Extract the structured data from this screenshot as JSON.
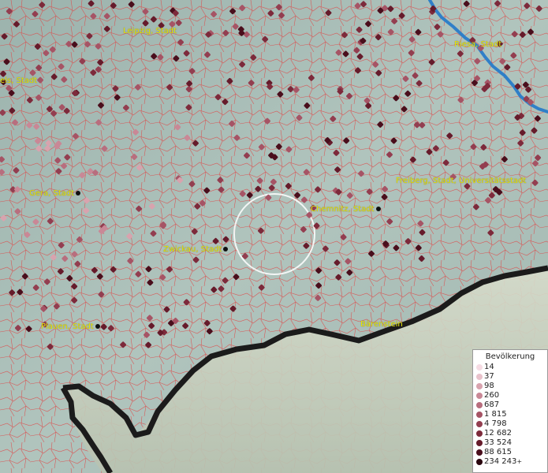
{
  "colors": {
    "background": "#a9bfb8",
    "district_border": "#e23a3a",
    "state_border": "#1b1b1b",
    "river": "#2f7fc8",
    "city_label": "#e8e600",
    "focus_circle": "#ffffff"
  },
  "cities": [
    {
      "name": "Leipzig, Stadt",
      "has_marker": false
    },
    {
      "name": "Riesa, Stadt",
      "has_marker": false
    },
    {
      "name": "els, Stadt",
      "has_marker": false
    },
    {
      "name": "Gera, Stadt",
      "has_marker": true
    },
    {
      "name": "Chemnitz, Stadt",
      "has_marker": true
    },
    {
      "name": "Freiberg, Stadt, Universitätsstadt",
      "has_marker": false
    },
    {
      "name": "Zwickau, Stadt",
      "has_marker": true
    },
    {
      "name": "Plauen, Stadt",
      "has_marker": true
    },
    {
      "name": "Bärenstein",
      "has_marker": false
    }
  ],
  "legend": {
    "title": "Bevölkerung",
    "classes": [
      {
        "label": "14",
        "color": "#f6dce4"
      },
      {
        "label": "37",
        "color": "#e8c2cb"
      },
      {
        "label": "98",
        "color": "#d8a3ae"
      },
      {
        "label": "260",
        "color": "#c98896"
      },
      {
        "label": "687",
        "color": "#b86e7e"
      },
      {
        "label": "1 815",
        "color": "#a65465"
      },
      {
        "label": "4 798",
        "color": "#933e50"
      },
      {
        "label": "12 682",
        "color": "#7d2a3b"
      },
      {
        "label": "33 524",
        "color": "#661b2b"
      },
      {
        "label": "88 615",
        "color": "#4a0e1c"
      },
      {
        "label": "234 243",
        "color": "#2a050e",
        "suffix": "+"
      }
    ]
  }
}
